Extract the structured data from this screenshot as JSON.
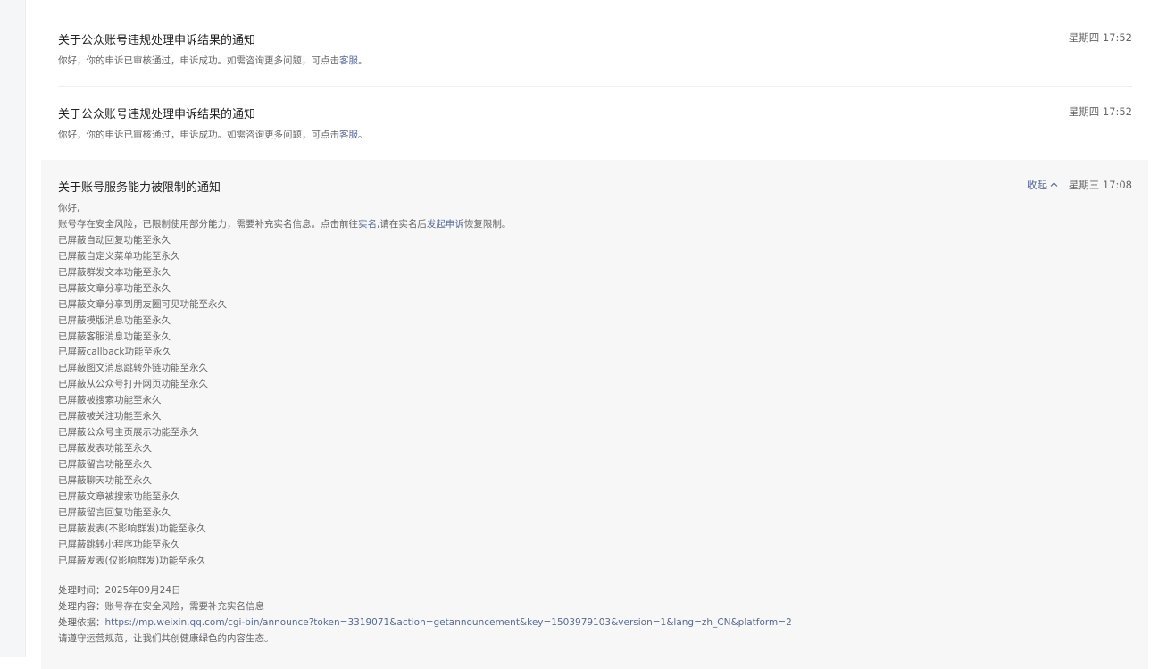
{
  "messages": [
    {
      "title": "关于公众账号违规处理申诉结果的通知",
      "time": "星期四 17:52",
      "summary_text": "你好，你的申诉已审核通过，申诉成功。如需咨询更多问题，可点击",
      "summary_link": "客服",
      "summary_end": "。"
    },
    {
      "title": "关于公众账号违规处理申诉结果的通知",
      "time": "星期四 17:52",
      "summary_text": "你好，你的申诉已审核通过，申诉成功。如需咨询更多问题，可点击",
      "summary_link": "客服",
      "summary_end": "。"
    }
  ],
  "expanded": {
    "title": "关于账号服务能力被限制的通知",
    "collapse_label": "收起",
    "time": "星期三 17:08",
    "greeting": "你好,",
    "intro_a": "账号存在安全风险，已限制使用部分能力，需要补充实名信息。点击前往",
    "intro_link1": "实名",
    "intro_b": ",请在实名后",
    "intro_link2": "发起申诉",
    "intro_c": "恢复限制。",
    "restrictions": [
      "已屏蔽自动回复功能至永久",
      "已屏蔽自定义菜单功能至永久",
      "已屏蔽群发文本功能至永久",
      "已屏蔽文章分享功能至永久",
      "已屏蔽文章分享到朋友圈可见功能至永久",
      "已屏蔽模版消息功能至永久",
      "已屏蔽客服消息功能至永久",
      "已屏蔽callback功能至永久",
      "已屏蔽图文消息跳转外链功能至永久",
      "已屏蔽从公众号打开网页功能至永久",
      "已屏蔽被搜索功能至永久",
      "已屏蔽被关注功能至永久",
      "已屏蔽公众号主页展示功能至永久",
      "已屏蔽发表功能至永久",
      "已屏蔽留言功能至永久",
      "已屏蔽聊天功能至永久",
      "已屏蔽文章被搜索功能至永久",
      "已屏蔽留言回复功能至永久",
      "已屏蔽发表(不影响群发)功能至永久",
      "已屏蔽跳转小程序功能至永久",
      "已屏蔽发表(仅影响群发)功能至永久"
    ],
    "process_time": "处理时间：2025年09月24日",
    "process_content": "处理内容：账号存在安全风险，需要补充实名信息",
    "process_basis_label": "处理依据：",
    "process_basis_url": "https://mp.weixin.qq.com/cgi-bin/announce?token=3319071&action=getannouncement&key=1503979103&version=1&lang=zh_CN&platform=2",
    "footer": "请遵守运营规范，让我们共创健康绿色的内容生态。"
  },
  "colors": {
    "link": "#576b95",
    "expanded_bg": "#f7f7f7",
    "gutter": "#f5f6f7"
  }
}
